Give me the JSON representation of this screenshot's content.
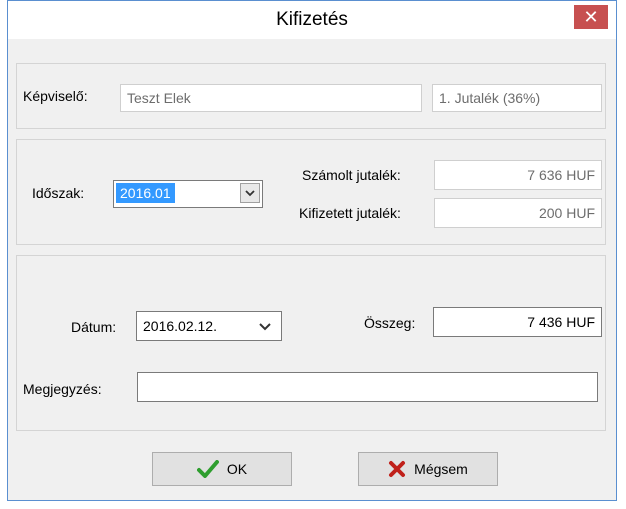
{
  "window": {
    "title": "Kifizetés",
    "close_glyph": "✕"
  },
  "representative": {
    "label": "Képviselő:",
    "value": "Teszt Elek",
    "commission_type": "1. Jutalék (36%)"
  },
  "period": {
    "label": "Időszak:",
    "selected": "2016.01",
    "calculated_label": "Számolt jutalék:",
    "calculated_value": "7 636 HUF",
    "paid_label": "Kifizetett jutalék:",
    "paid_value": "200 HUF"
  },
  "payment": {
    "date_label": "Dátum:",
    "date_value": "2016.02.12.",
    "amount_label": "Összeg:",
    "amount_value": "7 436 HUF",
    "note_label": "Megjegyzés:",
    "note_value": ""
  },
  "buttons": {
    "ok_label": "OK",
    "cancel_label": "Mégsem"
  },
  "icons": {
    "ok": "checkmark-icon",
    "cancel": "x-icon",
    "close": "close-icon",
    "dropdown": "chevron-down-icon"
  },
  "colors": {
    "close": "#c75050",
    "selection": "#3399ff",
    "ok_icon": "#2e9e2e",
    "cancel_icon": "#c0201a"
  }
}
